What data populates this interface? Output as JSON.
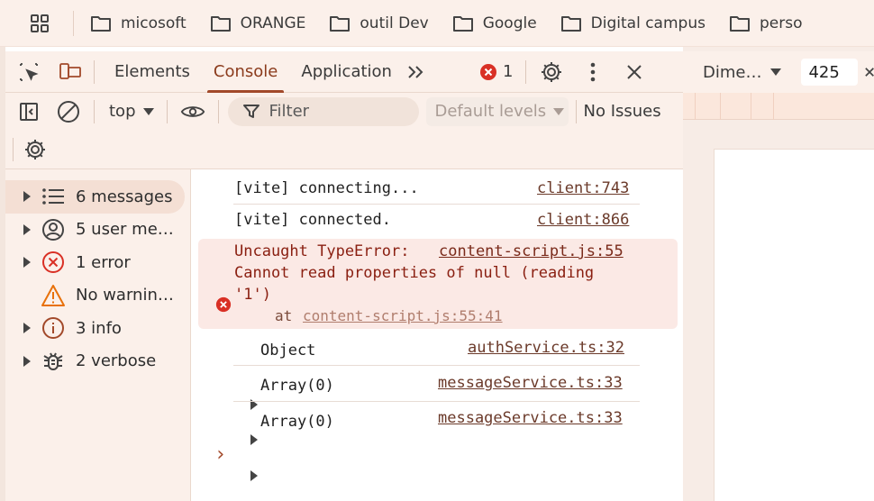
{
  "bookmarks": [
    {
      "label": "micosoft"
    },
    {
      "label": "ORANGE"
    },
    {
      "label": "outil Dev"
    },
    {
      "label": "Google"
    },
    {
      "label": "Digital campus"
    },
    {
      "label": "perso"
    }
  ],
  "devtools": {
    "tabs": [
      "Elements",
      "Console",
      "Application"
    ],
    "active_tab": "Console",
    "error_count": "1",
    "toolbar": {
      "context": "top",
      "filter_placeholder": "Filter",
      "levels": "Default levels",
      "issues": "No Issues"
    },
    "sidebar": [
      {
        "label": "6 messages",
        "icon": "list-icon"
      },
      {
        "label": "5 user me…",
        "icon": "user-icon"
      },
      {
        "label": "1 error",
        "icon": "error-icon"
      },
      {
        "label": "No warnin…",
        "icon": "warning-icon"
      },
      {
        "label": "3 info",
        "icon": "info-icon"
      },
      {
        "label": "2 verbose",
        "icon": "bug-icon"
      }
    ],
    "console": {
      "messages": [
        {
          "text": "[vite] connecting...",
          "source": "client:743"
        },
        {
          "text": "[vite] connected.",
          "source": "client:866"
        }
      ],
      "error": {
        "line1": "Uncaught TypeError:",
        "source": "content-script.js:55",
        "line2": "Cannot read properties of null (reading",
        "line3": "'1')",
        "at_prefix": "at",
        "at_link": "content-script.js:55:41"
      },
      "objects": [
        {
          "text": "Object",
          "source": "authService.ts:32"
        },
        {
          "text": "Array(0)",
          "source": "messageService.ts:33"
        },
        {
          "text": "Array(0)",
          "source": "messageService.ts:33"
        }
      ],
      "prompt": "›"
    }
  },
  "device_toolbar": {
    "dimensions_label": "Dime…",
    "width_value": "425"
  },
  "colors": {
    "accent": "#a2492a",
    "error_red": "#d93025",
    "error_bg": "#fbe9e5"
  }
}
